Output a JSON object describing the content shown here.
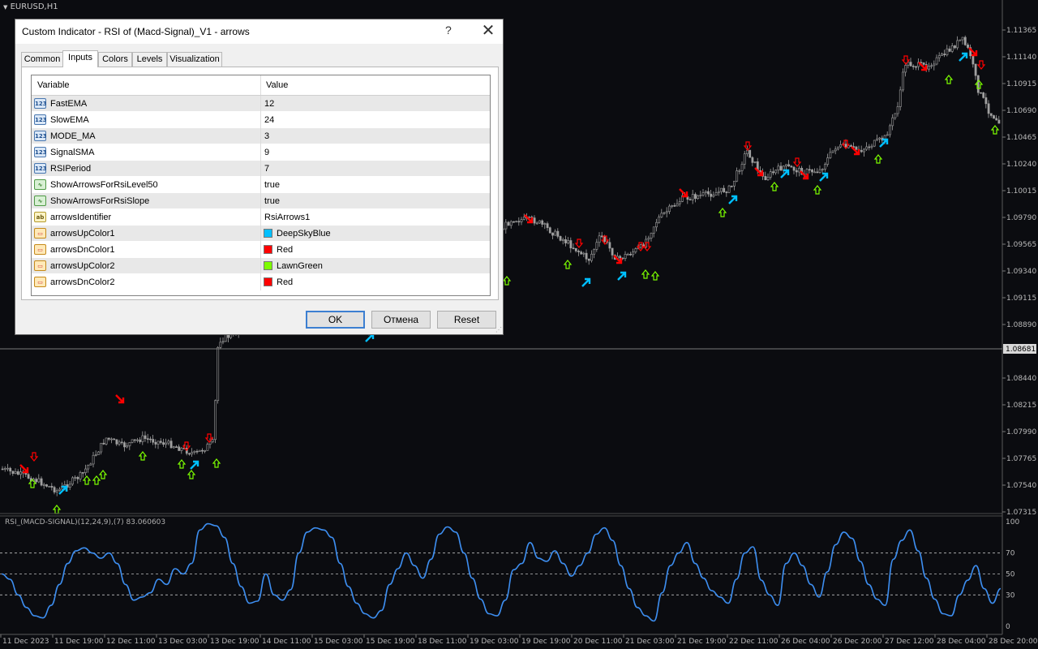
{
  "chart": {
    "symbol": "EURUSD,H1",
    "current_price": "1.08681",
    "price_ticks": [
      "1.11365",
      "1.11140",
      "1.10915",
      "1.10690",
      "1.10465",
      "1.10240",
      "1.10015",
      "1.09790",
      "1.09565",
      "1.09340",
      "1.09115",
      "1.08890",
      "1.08681",
      "1.08440",
      "1.08215",
      "1.07990",
      "1.07765",
      "1.07540",
      "1.07315"
    ],
    "time_labels": [
      "11 Dec 2023",
      "11 Dec 19:00",
      "12 Dec 11:00",
      "13 Dec 03:00",
      "13 Dec 19:00",
      "14 Dec 11:00",
      "15 Dec 03:00",
      "15 Dec 19:00",
      "18 Dec 11:00",
      "19 Dec 03:00",
      "19 Dec 19:00",
      "20 Dec 11:00",
      "21 Dec 03:00",
      "21 Dec 19:00",
      "22 Dec 11:00",
      "26 Dec 04:00",
      "26 Dec 20:00",
      "27 Dec 12:00",
      "28 Dec 04:00",
      "28 Dec 20:00"
    ],
    "colors": {
      "background": "#0b0c10",
      "candle": "#a0a0a0",
      "grid": "#2a2a2a",
      "arrow_up_1": "#00bfff",
      "arrow_dn_1": "#ff0000",
      "arrow_up_2": "#7cfc00",
      "arrow_dn_2": "#ff0000"
    }
  },
  "subwindow": {
    "title": "RSI_(MACD-SIGNAL)(12,24,9),(7) 83.060603",
    "levels": [
      "100",
      "70",
      "50",
      "30",
      "0"
    ],
    "line_color": "#3d8ef0"
  },
  "chart_data": {
    "type": "line",
    "title": "RSI_(MACD-SIGNAL)(12,24,9),(7) 83.060603",
    "xlabel": "",
    "ylabel": "",
    "ylim": [
      0,
      100
    ],
    "levels": [
      30,
      50,
      70
    ],
    "x_tick_labels": [
      "11 Dec 2023",
      "11 Dec 19:00",
      "12 Dec 11:00",
      "13 Dec 03:00",
      "13 Dec 19:00",
      "14 Dec 11:00",
      "15 Dec 03:00",
      "15 Dec 19:00",
      "18 Dec 11:00",
      "19 Dec 03:00",
      "19 Dec 19:00",
      "20 Dec 11:00",
      "21 Dec 03:00",
      "21 Dec 19:00",
      "22 Dec 11:00",
      "26 Dec 04:00",
      "26 Dec 20:00",
      "27 Dec 12:00",
      "28 Dec 04:00",
      "28 Dec 20:00"
    ],
    "series": [
      {
        "name": "RSI_(MACD-SIGNAL)",
        "color": "#3d8ef0",
        "values": [
          50,
          45,
          30,
          18,
          10,
          8,
          20,
          40,
          60,
          72,
          75,
          70,
          65,
          70,
          60,
          40,
          25,
          28,
          32,
          45,
          40,
          55,
          50,
          60,
          92,
          98,
          96,
          85,
          60,
          38,
          22,
          24,
          50,
          30,
          25,
          35,
          70,
          90,
          94,
          92,
          85,
          60,
          38,
          22,
          12,
          8,
          15,
          40,
          55,
          70,
          58,
          46,
          64,
          88,
          95,
          90,
          70,
          46,
          26,
          12,
          10,
          25,
          54,
          60,
          80,
          65,
          62,
          72,
          60,
          48,
          58,
          70,
          88,
          94,
          82,
          58,
          36,
          18,
          10,
          5,
          32,
          58,
          70,
          80,
          60,
          46,
          34,
          28,
          22,
          45,
          70,
          76,
          44,
          30,
          20,
          60,
          70,
          58,
          40,
          28,
          52,
          78,
          90,
          84,
          62,
          40,
          26,
          20,
          64,
          82,
          92,
          72,
          46,
          26,
          12,
          10,
          30,
          44,
          58,
          36,
          22,
          36
        ]
      }
    ]
  },
  "dialog": {
    "title": "Custom Indicator - RSI of (Macd-Signal)_V1 - arrows",
    "help": "?",
    "close": "✕",
    "tabs": [
      "Common",
      "Inputs",
      "Colors",
      "Levels",
      "Visualization"
    ],
    "active_tab": "Inputs",
    "columns": {
      "variable": "Variable",
      "value": "Value"
    },
    "rows": [
      {
        "name": "FastEMA",
        "value": "12",
        "type": "num",
        "icon": "number-icon"
      },
      {
        "name": "SlowEMA",
        "value": "24",
        "type": "num",
        "icon": "number-icon"
      },
      {
        "name": "MODE_MA",
        "value": "3",
        "type": "num",
        "icon": "number-icon"
      },
      {
        "name": "SignalSMA",
        "value": "9",
        "type": "num",
        "icon": "number-icon"
      },
      {
        "name": "RSIPeriod",
        "value": "7",
        "type": "num",
        "icon": "number-icon"
      },
      {
        "name": "ShowArrowsForRsiLevel50",
        "value": "true",
        "type": "bool",
        "icon": "boolean-icon"
      },
      {
        "name": "ShowArrowsForRsiSlope",
        "value": "true",
        "type": "bool",
        "icon": "boolean-icon"
      },
      {
        "name": "arrowsIdentifier",
        "value": "RsiArrows1",
        "type": "str",
        "icon": "string-icon"
      },
      {
        "name": "arrowsUpColor1",
        "value": "DeepSkyBlue",
        "type": "clr",
        "icon": "color-icon",
        "color": "#00bfff"
      },
      {
        "name": "arrowsDnColor1",
        "value": "Red",
        "type": "clr",
        "icon": "color-icon",
        "color": "#ff0000"
      },
      {
        "name": "arrowsUpColor2",
        "value": "LawnGreen",
        "type": "clr",
        "icon": "color-icon",
        "color": "#7cfc00"
      },
      {
        "name": "arrowsDnColor2",
        "value": "Red",
        "type": "clr",
        "icon": "color-icon",
        "color": "#ff0000"
      }
    ],
    "buttons": {
      "ok": "OK",
      "cancel": "Отмена",
      "reset": "Reset"
    }
  }
}
